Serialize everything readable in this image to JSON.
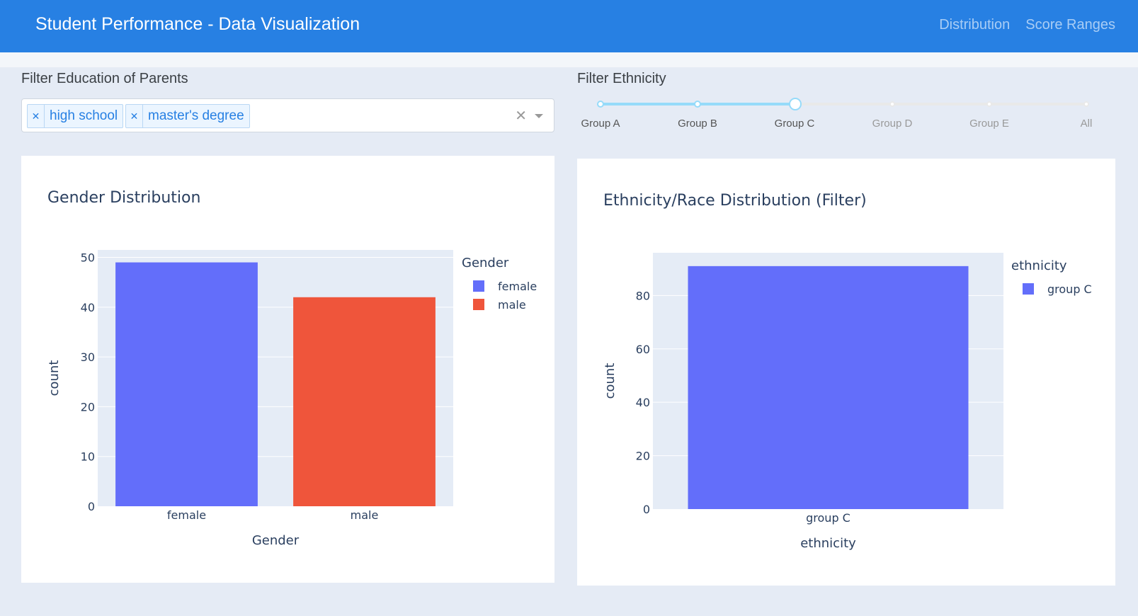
{
  "navbar": {
    "title": "Student Performance - Data Visualization",
    "links": [
      "Distribution",
      "Score Ranges"
    ],
    "color": "#2780e3"
  },
  "filters": {
    "education": {
      "label": "Filter Education of Parents",
      "selected": [
        "high school",
        "master's degree"
      ],
      "clear_icon": "clear-icon",
      "arrow_icon": "chevron-down-icon"
    },
    "ethnicity": {
      "label": "Filter Ethnicity",
      "marks": [
        "Group A",
        "Group B",
        "Group C",
        "Group D",
        "Group E",
        "All"
      ],
      "selected": "Group C"
    }
  },
  "chart_data": [
    {
      "type": "bar",
      "title": "Gender Distribution",
      "xlabel": "Gender",
      "ylabel": "count",
      "categories": [
        "female",
        "male"
      ],
      "values": [
        49,
        42
      ],
      "colors": [
        "#636efa",
        "#ef553b"
      ],
      "ylim": [
        0,
        51.5
      ],
      "yticks": [
        0,
        10,
        20,
        30,
        40,
        50
      ],
      "grid": true,
      "legend": {
        "title": "Gender",
        "entries": [
          "female",
          "male"
        ],
        "placement": "right"
      }
    },
    {
      "type": "bar",
      "title": "Ethnicity/Race Distribution (Filter)",
      "xlabel": "ethnicity",
      "ylabel": "count",
      "categories": [
        "group C"
      ],
      "values": [
        91
      ],
      "colors": [
        "#636efa"
      ],
      "ylim": [
        0,
        96
      ],
      "yticks": [
        0,
        20,
        40,
        60,
        80
      ],
      "grid": true,
      "legend": {
        "title": "ethnicity",
        "entries": [
          "group C"
        ],
        "placement": "right"
      }
    }
  ]
}
